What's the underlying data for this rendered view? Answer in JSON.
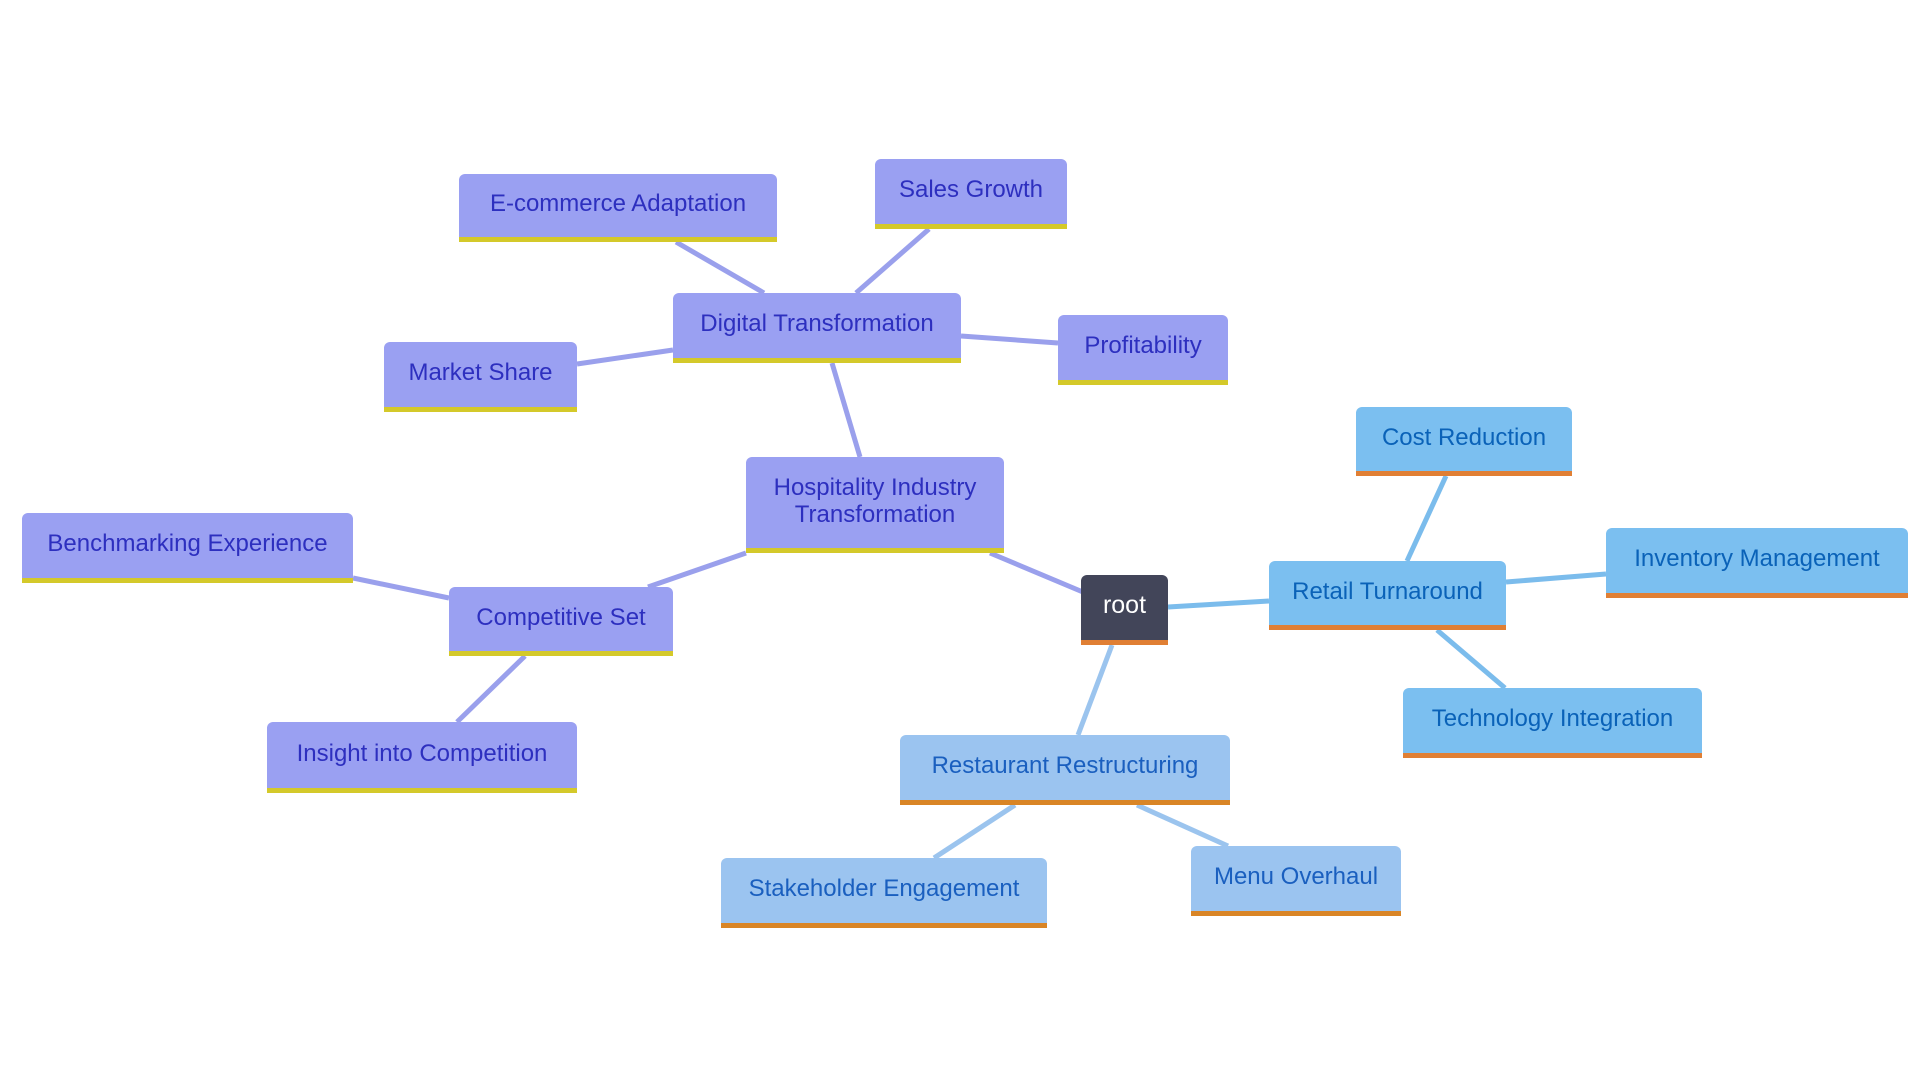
{
  "diagram": {
    "type": "mindmap",
    "colors": {
      "root_fill": "#424559",
      "root_text": "#ffffff",
      "purple_fill": "#9aa0f2",
      "purple_text": "#2d2fbf",
      "purple_underline": "#d4c92a",
      "purple_edge": "#9aa0ec",
      "blue_fill": "#7bbff0",
      "blue_text": "#0a62b8",
      "blue_edge": "#7bbcec",
      "lightblue_fill": "#9bc4f0",
      "lightblue_text": "#1a5fbf",
      "lightblue_edge": "#9bc4ee",
      "orange_underline": "#e07f34"
    },
    "nodes": {
      "root": "root",
      "hospitality": "Hospitality Industry Transformation",
      "digital": "Digital Transformation",
      "ecommerce": "E-commerce Adaptation",
      "sales_growth": "Sales Growth",
      "profitability": "Profitability",
      "market_share": "Market Share",
      "competitive_set": "Competitive Set",
      "benchmarking": "Benchmarking Experience",
      "insight": "Insight into Competition",
      "retail": "Retail Turnaround",
      "cost_reduction": "Cost Reduction",
      "inventory": "Inventory Management",
      "technology": "Technology Integration",
      "restaurant": "Restaurant Restructuring",
      "stakeholder": "Stakeholder Engagement",
      "menu": "Menu Overhaul"
    },
    "edges": [
      [
        "root",
        "hospitality"
      ],
      [
        "root",
        "retail"
      ],
      [
        "root",
        "restaurant"
      ],
      [
        "hospitality",
        "digital"
      ],
      [
        "hospitality",
        "competitive_set"
      ],
      [
        "digital",
        "ecommerce"
      ],
      [
        "digital",
        "sales_growth"
      ],
      [
        "digital",
        "profitability"
      ],
      [
        "digital",
        "market_share"
      ],
      [
        "competitive_set",
        "benchmarking"
      ],
      [
        "competitive_set",
        "insight"
      ],
      [
        "retail",
        "cost_reduction"
      ],
      [
        "retail",
        "inventory"
      ],
      [
        "retail",
        "technology"
      ],
      [
        "restaurant",
        "stakeholder"
      ],
      [
        "restaurant",
        "menu"
      ]
    ]
  }
}
